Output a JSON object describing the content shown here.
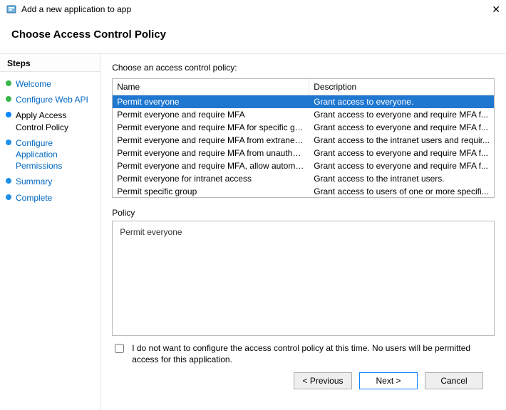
{
  "window": {
    "title": "Add a new application to app"
  },
  "header": {
    "title": "Choose Access Control Policy"
  },
  "sidebar": {
    "title": "Steps",
    "items": [
      {
        "label": "Welcome",
        "state": "completed"
      },
      {
        "label": "Configure Web API",
        "state": "completed"
      },
      {
        "label": "Apply Access Control Policy",
        "state": "current"
      },
      {
        "label": "Configure Application Permissions",
        "state": "pending"
      },
      {
        "label": "Summary",
        "state": "pending"
      },
      {
        "label": "Complete",
        "state": "pending"
      }
    ]
  },
  "main": {
    "prompt": "Choose an access control policy:",
    "columns": {
      "name": "Name",
      "description": "Description"
    },
    "policies": [
      {
        "name": "Permit everyone",
        "description": "Grant access to everyone.",
        "selected": true
      },
      {
        "name": "Permit everyone and require MFA",
        "description": "Grant access to everyone and require MFA f..."
      },
      {
        "name": "Permit everyone and require MFA for specific group",
        "description": "Grant access to everyone and require MFA f..."
      },
      {
        "name": "Permit everyone and require MFA from extranet access",
        "description": "Grant access to the intranet users and requir..."
      },
      {
        "name": "Permit everyone and require MFA from unauthenticated ...",
        "description": "Grant access to everyone and require MFA f..."
      },
      {
        "name": "Permit everyone and require MFA, allow automatic devi...",
        "description": "Grant access to everyone and require MFA f..."
      },
      {
        "name": "Permit everyone for intranet access",
        "description": "Grant access to the intranet users."
      },
      {
        "name": "Permit specific group",
        "description": "Grant access to users of one or more specifi..."
      }
    ],
    "policy_section_label": "Policy",
    "policy_preview": "Permit everyone",
    "skip": {
      "checked": false,
      "label": "I do not want to configure the access control policy at this time.  No users will be permitted access for this application."
    }
  },
  "footer": {
    "previous": "< Previous",
    "next": "Next >",
    "cancel": "Cancel"
  }
}
